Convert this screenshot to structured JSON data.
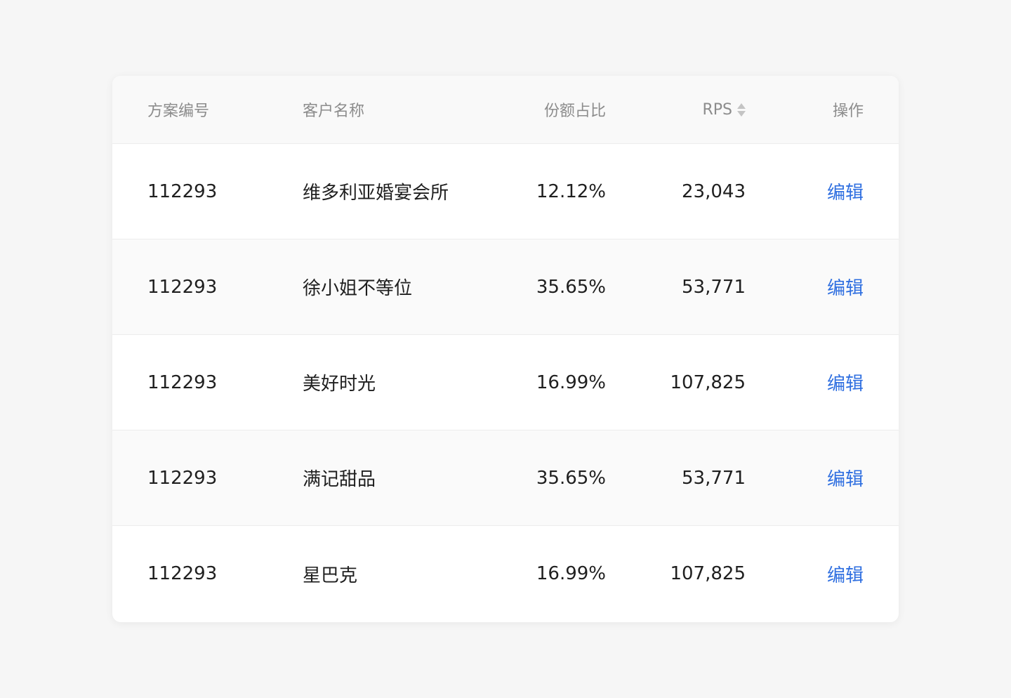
{
  "table": {
    "columns": {
      "id": "方案编号",
      "name": "客户名称",
      "share": "份额占比",
      "rps": "RPS",
      "action": "操作"
    },
    "rows": [
      {
        "id": "112293",
        "name": "维多利亚婚宴会所",
        "share": "12.12%",
        "rps": "23,043",
        "action": "编辑"
      },
      {
        "id": "112293",
        "name": "徐小姐不等位",
        "share": "35.65%",
        "rps": "53,771",
        "action": "编辑"
      },
      {
        "id": "112293",
        "name": "美好时光",
        "share": "16.99%",
        "rps": "107,825",
        "action": "编辑"
      },
      {
        "id": "112293",
        "name": "满记甜品",
        "share": "35.65%",
        "rps": "53,771",
        "action": "编辑"
      },
      {
        "id": "112293",
        "name": "星巴克",
        "share": "16.99%",
        "rps": "107,825",
        "action": "编辑"
      }
    ]
  },
  "icons": {
    "rps_sort": "sort-icon"
  },
  "colors": {
    "link": "#2f6fe0",
    "header_text": "#8c8c8c",
    "body_text": "#1f1f1f",
    "page_bg": "#f6f6f6"
  }
}
